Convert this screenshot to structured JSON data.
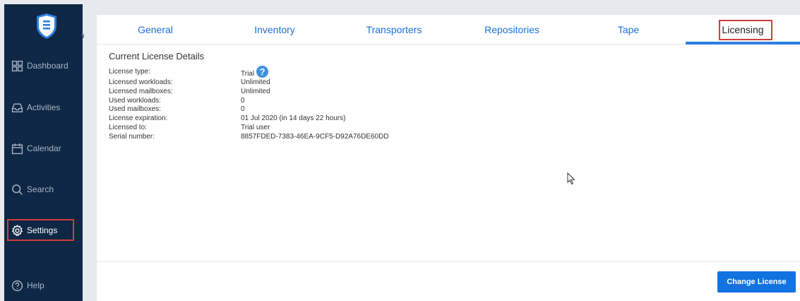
{
  "sidebar": {
    "items": [
      {
        "label": "Dashboard",
        "icon": "dashboard-icon"
      },
      {
        "label": "Activities",
        "icon": "inbox-icon"
      },
      {
        "label": "Calendar",
        "icon": "calendar-icon"
      },
      {
        "label": "Search",
        "icon": "search-icon"
      },
      {
        "label": "Settings",
        "icon": "gear-icon"
      },
      {
        "label": "Help",
        "icon": "help-icon"
      }
    ]
  },
  "tabs": [
    {
      "label": "General"
    },
    {
      "label": "Inventory"
    },
    {
      "label": "Transporters"
    },
    {
      "label": "Repositories"
    },
    {
      "label": "Tape"
    },
    {
      "label": "Licensing"
    }
  ],
  "details": {
    "title": "Current License Details",
    "rows": [
      {
        "key": "License type:",
        "value": "Trial"
      },
      {
        "key": "Licensed workloads:",
        "value": "Unlimited"
      },
      {
        "key": "Licensed mailboxes:",
        "value": "Unlimited"
      },
      {
        "key": "Used workloads:",
        "value": "0"
      },
      {
        "key": "Used mailboxes:",
        "value": "0"
      },
      {
        "key": "License expiration:",
        "value": "01 Jul 2020 (in 14 days 22 hours)"
      },
      {
        "key": "Licensed to:",
        "value": "Trial user"
      },
      {
        "key": "Serial number:",
        "value": "8857FDED-7383-46EA-9CF5-D92A76DE60DD"
      }
    ],
    "help_glyph": "?"
  },
  "actions": {
    "change_license": "Change License"
  },
  "colors": {
    "sidebar": "#0e2744",
    "accent": "#1173e0",
    "highlight": "#d23c3c",
    "tab_text": "#1d6fd6"
  }
}
